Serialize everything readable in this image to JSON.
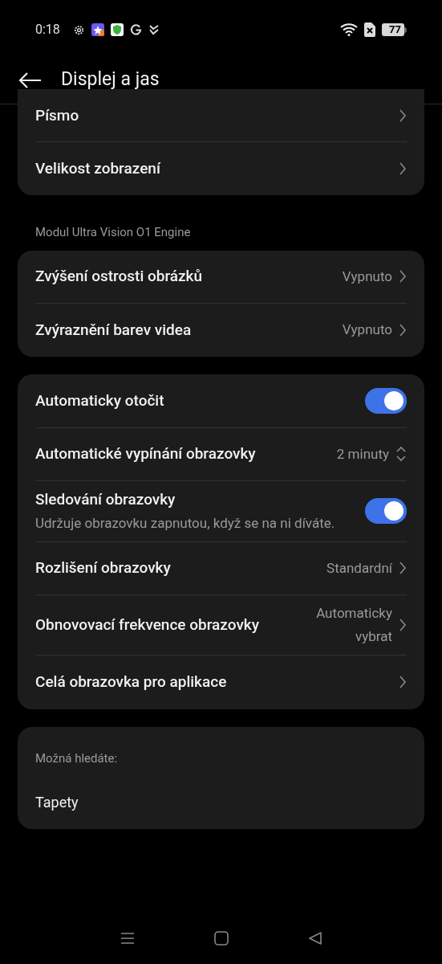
{
  "status_bar": {
    "time": "0:18",
    "battery": "77"
  },
  "header": {
    "title": "Displej a jas"
  },
  "groups": [
    {
      "rows": [
        {
          "kind": "link",
          "label": "Písmo"
        },
        {
          "kind": "link",
          "label": "Velikost zobrazení"
        }
      ]
    },
    {
      "heading": "Modul Ultra Vision O1 Engine",
      "rows": [
        {
          "kind": "link",
          "label": "Zvýšení ostrosti obrázků",
          "value": "Vypnuto"
        },
        {
          "kind": "link",
          "label": "Zvýraznění barev videa",
          "value": "Vypnuto"
        }
      ]
    },
    {
      "rows": [
        {
          "kind": "toggle",
          "label": "Automaticky otočit",
          "on": true
        },
        {
          "kind": "select",
          "label": "Automatické vypínání obrazovky",
          "value": "2 minuty"
        },
        {
          "kind": "toggle",
          "label": "Sledování obrazovky",
          "description": "Udržuje obrazovku zapnutou, když se na ni díváte.",
          "on": true
        },
        {
          "kind": "link",
          "label": "Rozlišení obrazovky",
          "value": "Standardní"
        },
        {
          "kind": "link",
          "label": "Obnovovací frekvence obrazovky",
          "value": "Automaticky vybrat"
        },
        {
          "kind": "link",
          "label": "Celá obrazovka pro aplikace"
        }
      ]
    }
  ],
  "suggestions": {
    "heading": "Možná hledáte:",
    "items": [
      "Tapety"
    ]
  }
}
